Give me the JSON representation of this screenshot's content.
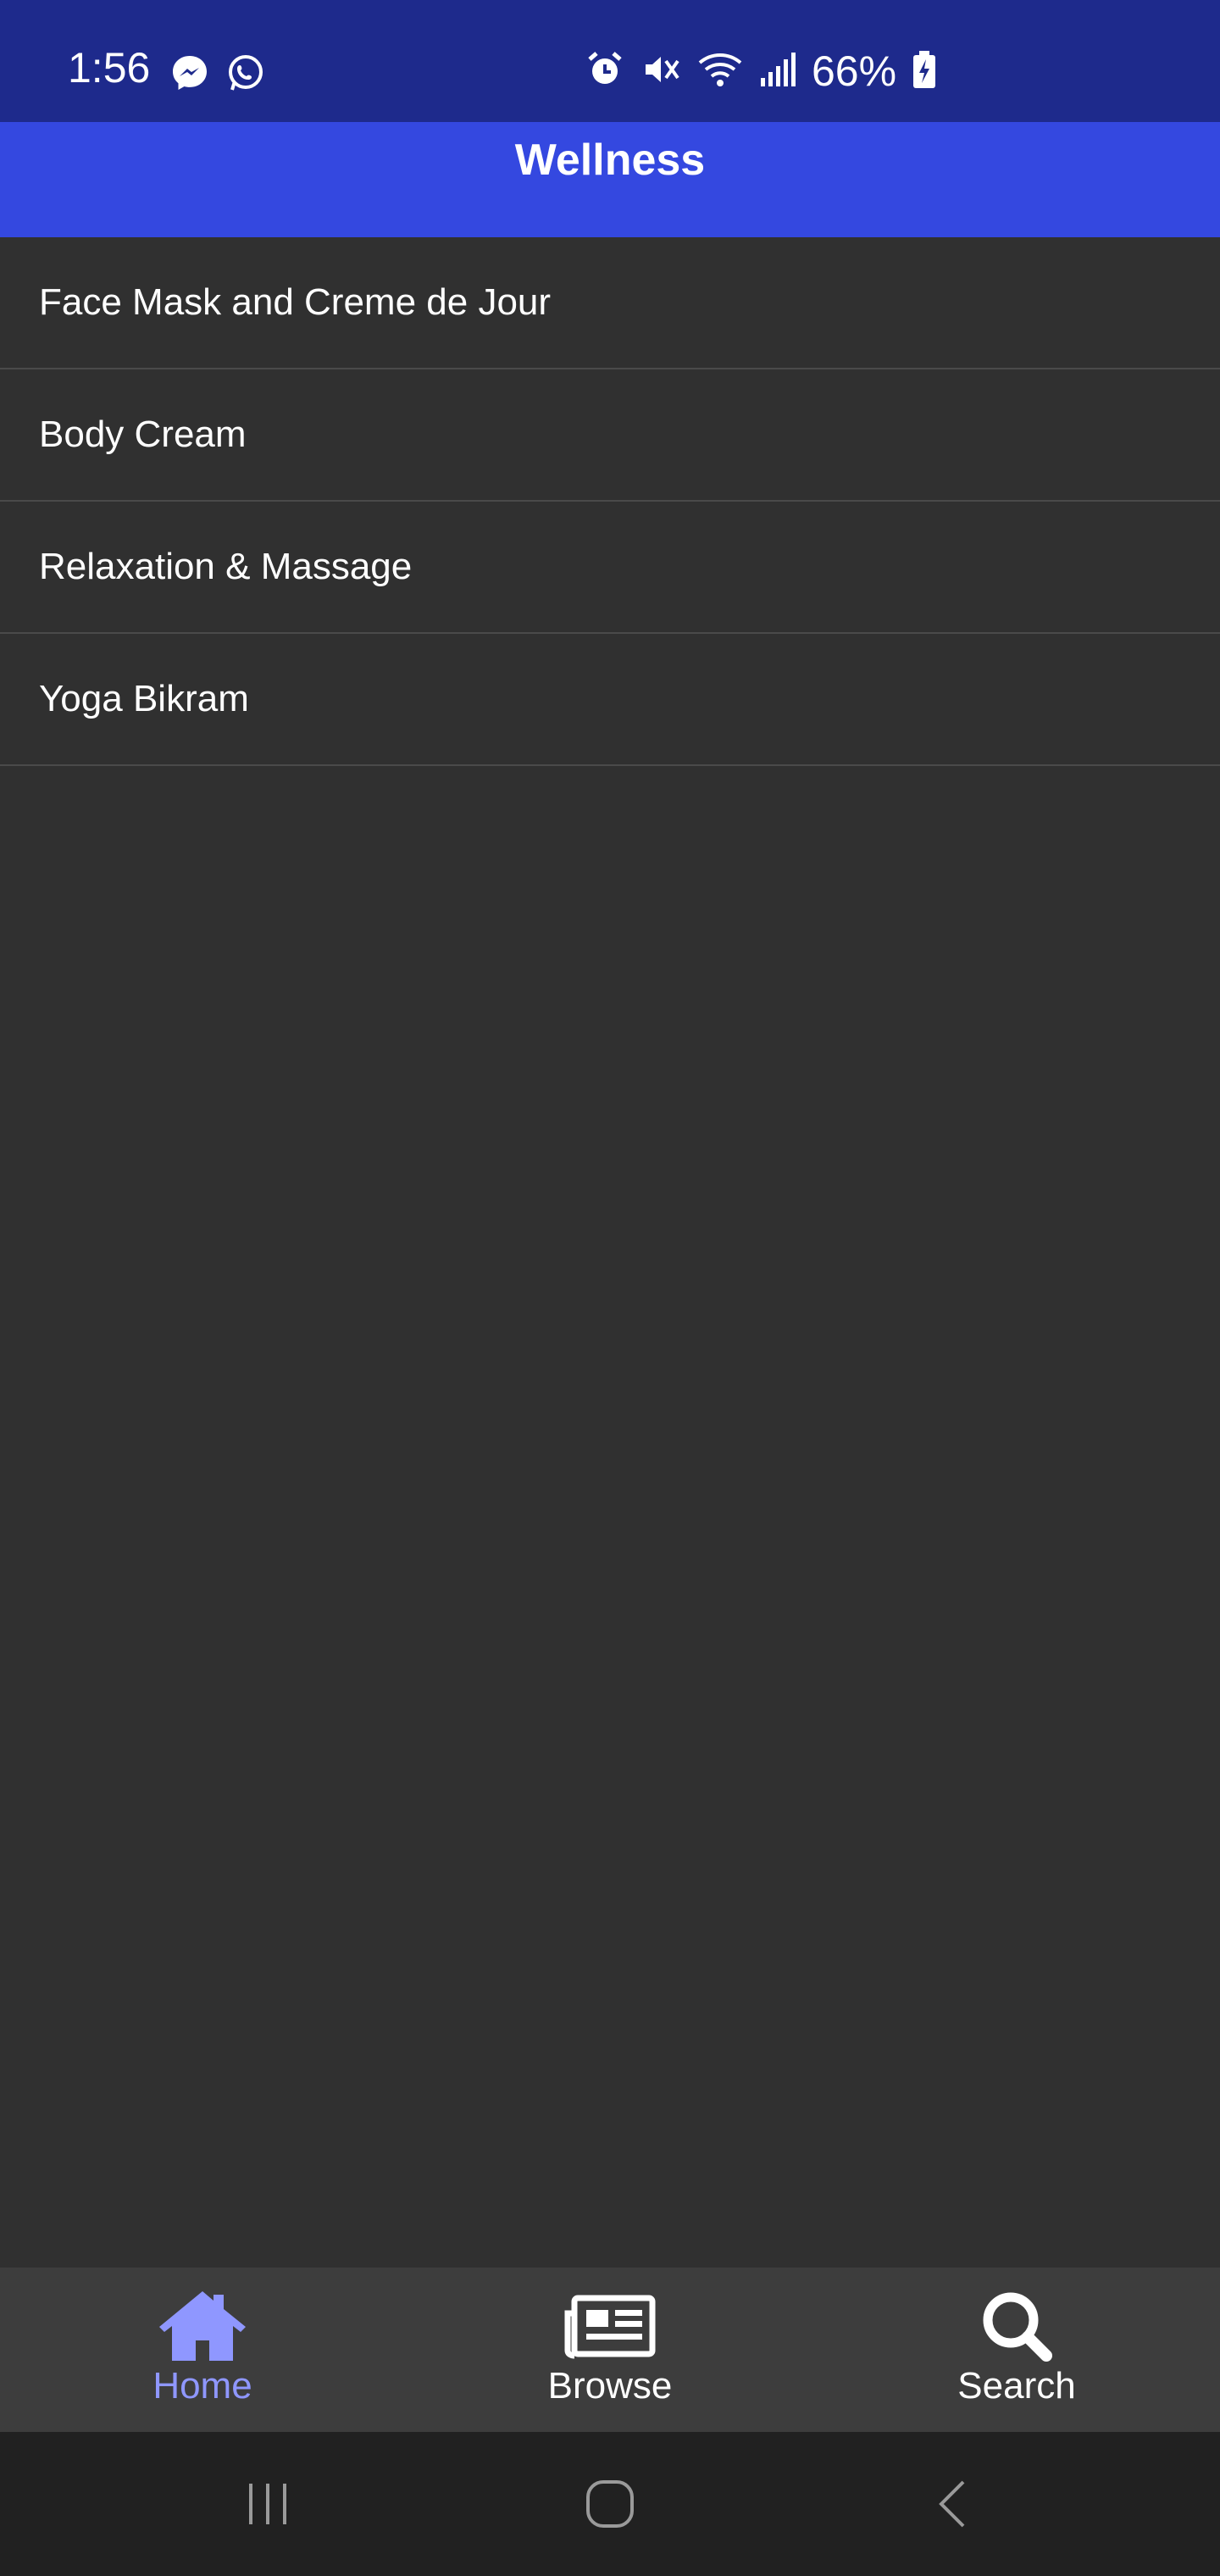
{
  "status_bar": {
    "time": "1:56",
    "battery_percent": "66%",
    "icons_left": [
      "messenger-icon",
      "whatsapp-icon"
    ],
    "icons_right": [
      "alarm-icon",
      "mute-icon",
      "wifi-icon",
      "signal-icon",
      "battery-charging-icon"
    ]
  },
  "app_bar": {
    "title": "Wellness",
    "color": "#3448e0"
  },
  "list": {
    "items": [
      {
        "label": "Face Mask and Creme de Jour"
      },
      {
        "label": "Body Cream"
      },
      {
        "label": "Relaxation & Massage"
      },
      {
        "label": "Yoga Bikram"
      }
    ]
  },
  "bottom_nav": {
    "items": [
      {
        "label": "Home",
        "icon": "home-icon",
        "active": true
      },
      {
        "label": "Browse",
        "icon": "newspaper-icon",
        "active": false
      },
      {
        "label": "Search",
        "icon": "search-icon",
        "active": false
      }
    ],
    "active_color": "#8f97ff"
  },
  "system_nav": {
    "buttons": [
      "recent-apps-icon",
      "home-circle-icon",
      "back-icon"
    ]
  }
}
